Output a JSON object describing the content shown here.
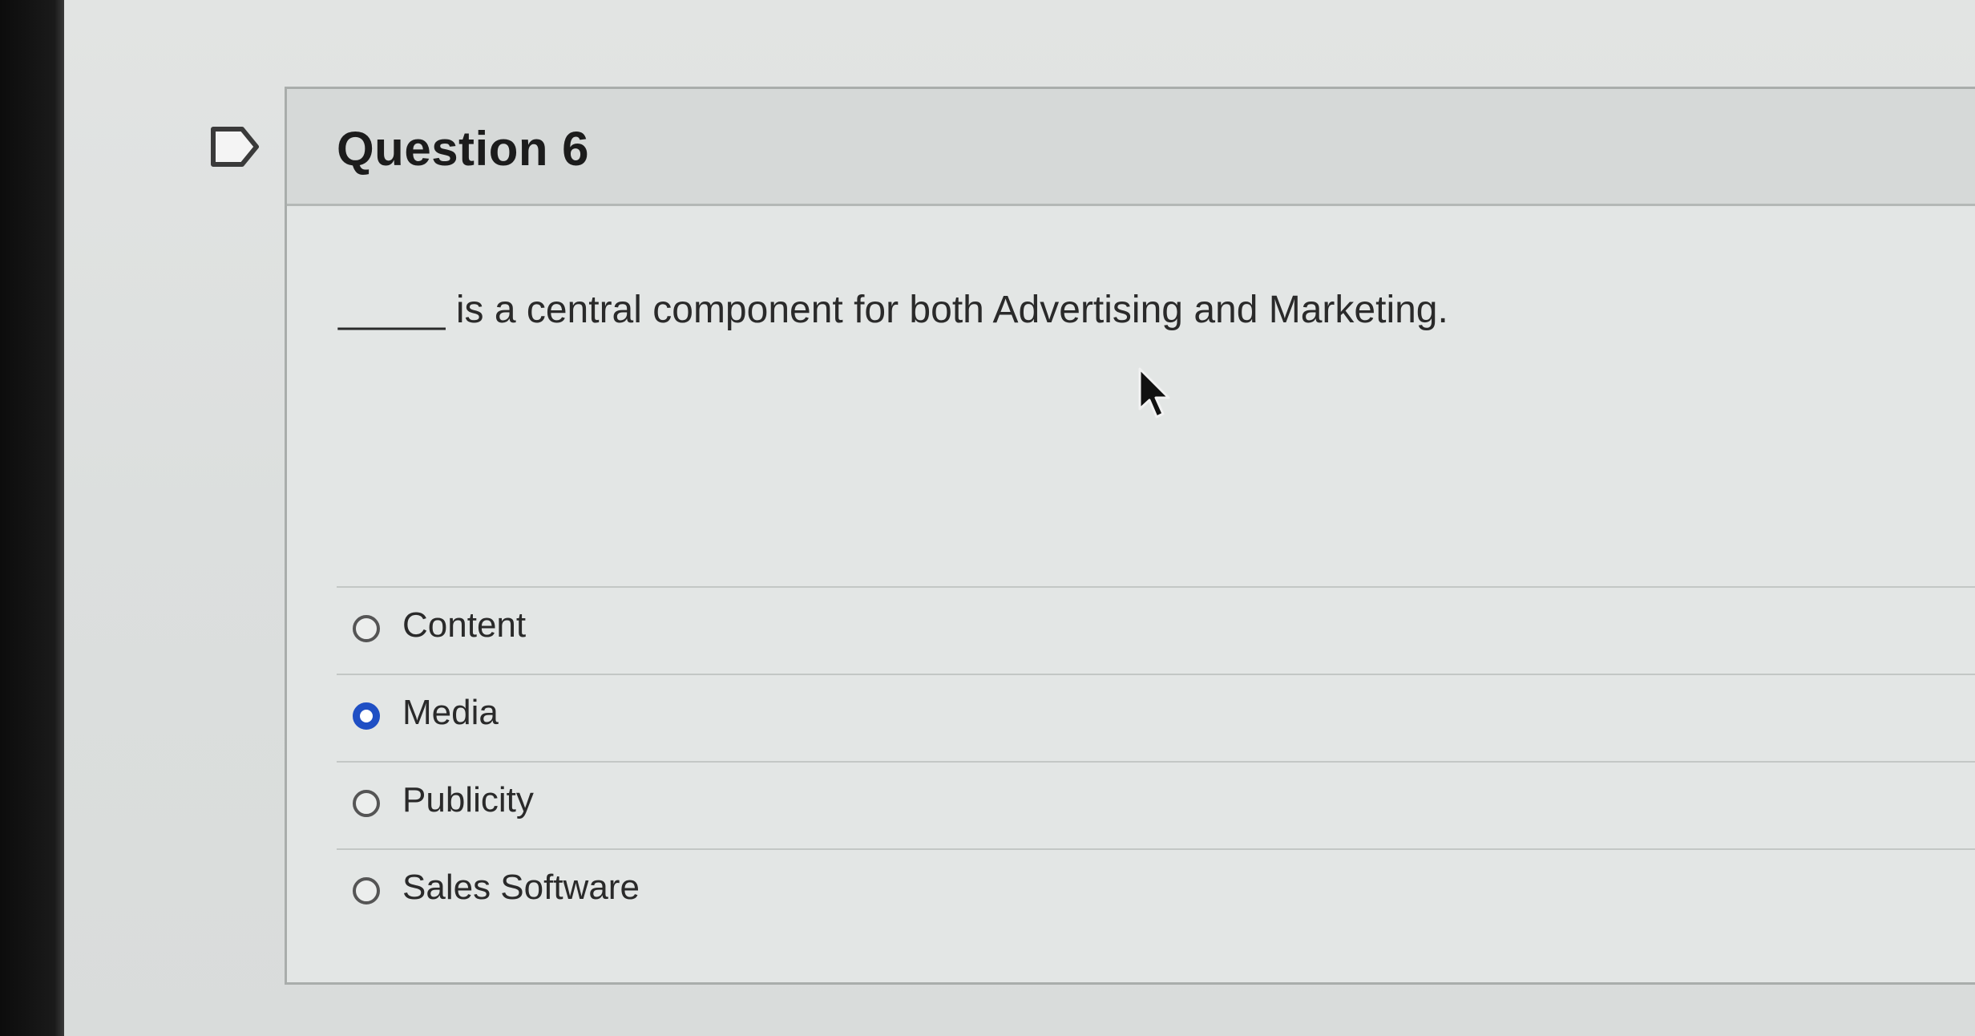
{
  "question": {
    "title": "Question 6",
    "text": "_____ is a central component for both Advertising and Marketing."
  },
  "answers": [
    {
      "label": "Content",
      "selected": false
    },
    {
      "label": "Media",
      "selected": true
    },
    {
      "label": "Publicity",
      "selected": false
    },
    {
      "label": "Sales Software",
      "selected": false
    }
  ],
  "icons": {
    "flag": "flag-icon",
    "cursor": "mouse-pointer-icon"
  },
  "colors": {
    "selected_radio": "#1f4fc4"
  }
}
